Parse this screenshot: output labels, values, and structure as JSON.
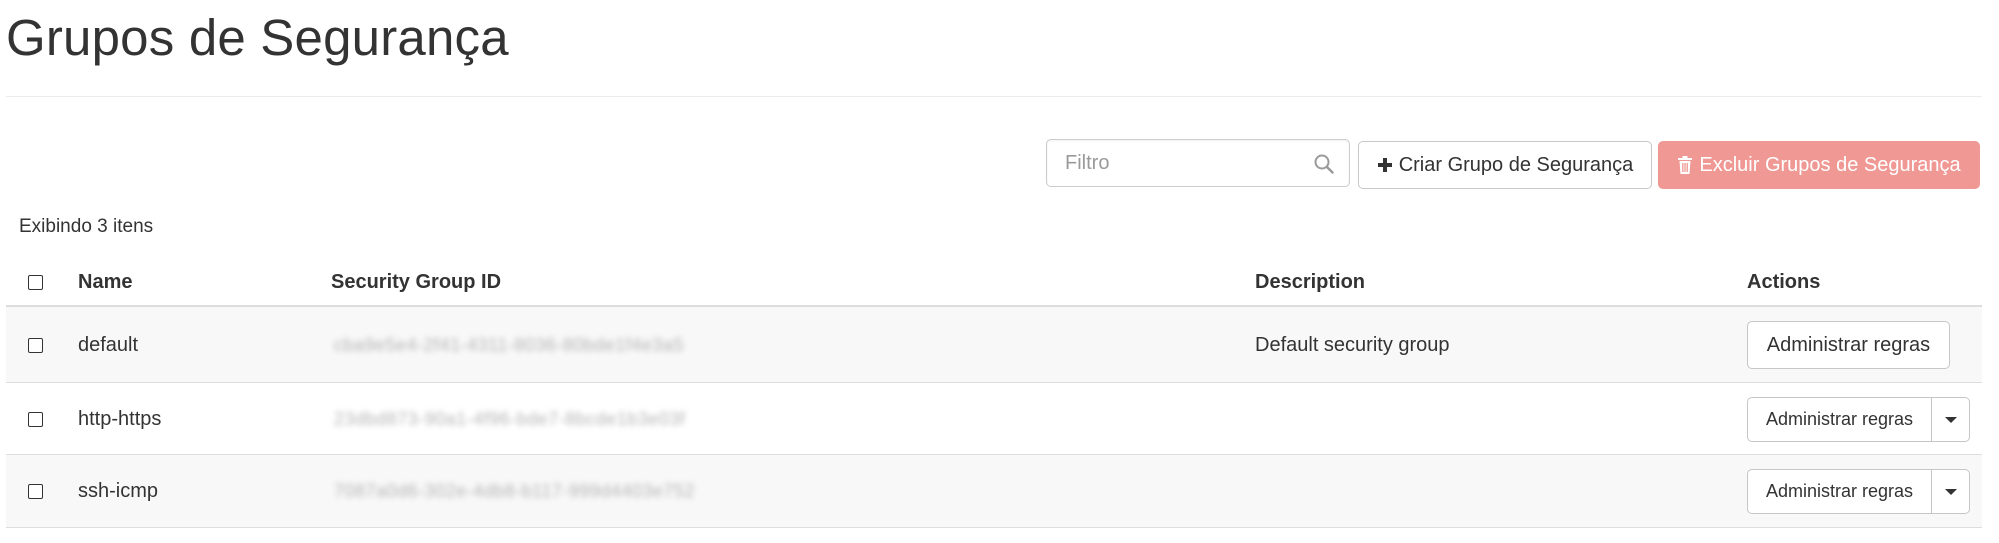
{
  "page": {
    "title": "Grupos de Segurança"
  },
  "toolbar": {
    "filter_placeholder": "Filtro",
    "filter_value": "",
    "create_label": "Criar Grupo de Segurança",
    "delete_label": "Excluir Grupos de Segurança",
    "delete_color": "#ef9894"
  },
  "table": {
    "count_text": "Exibindo 3 itens",
    "columns": {
      "name": "Name",
      "id": "Security Group ID",
      "description": "Description",
      "actions": "Actions"
    },
    "rows": [
      {
        "name": "default",
        "id": "cba9e5e4-2f41-4311-8036-80bde1f4e3a5",
        "description": "Default security group",
        "action_label": "Administrar regras",
        "has_dropdown": false
      },
      {
        "name": "http-https",
        "id": "23dbd873-90a1-4f96-bde7-8bcde1b3e03f",
        "description": "",
        "action_label": "Administrar regras",
        "has_dropdown": true
      },
      {
        "name": "ssh-icmp",
        "id": "7087a0d6-302e-4db8-b117-999d4403e752",
        "description": "",
        "action_label": "Administrar regras",
        "has_dropdown": true
      }
    ]
  }
}
